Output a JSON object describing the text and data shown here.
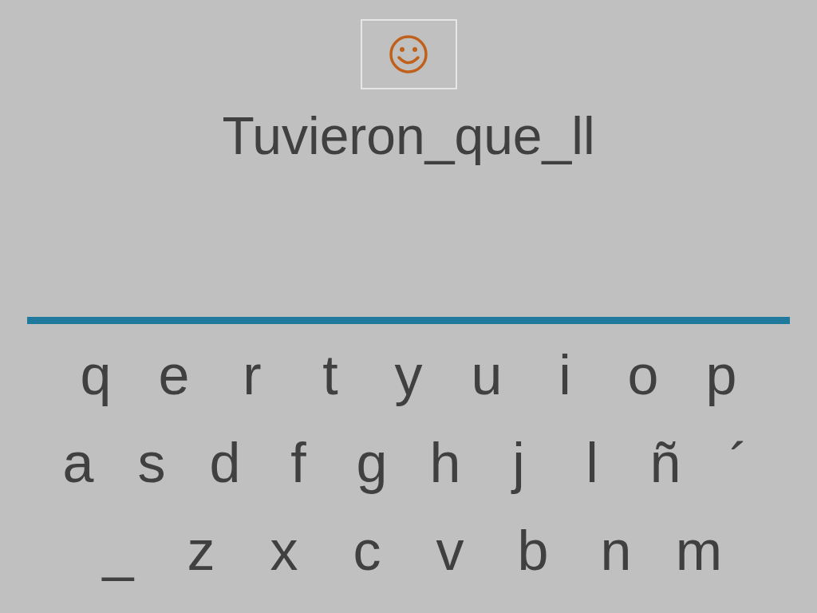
{
  "word": "Tuvieron_que_ll",
  "keyboard": {
    "rows": [
      [
        "q",
        "e",
        "r",
        "t",
        "y",
        "u",
        "i",
        "o",
        "p"
      ],
      [
        "a",
        "s",
        "d",
        "f",
        "g",
        "h",
        "j",
        "l",
        "ñ",
        "´"
      ],
      [
        "_",
        "z",
        "x",
        "c",
        "v",
        "b",
        "n",
        "m"
      ]
    ]
  }
}
